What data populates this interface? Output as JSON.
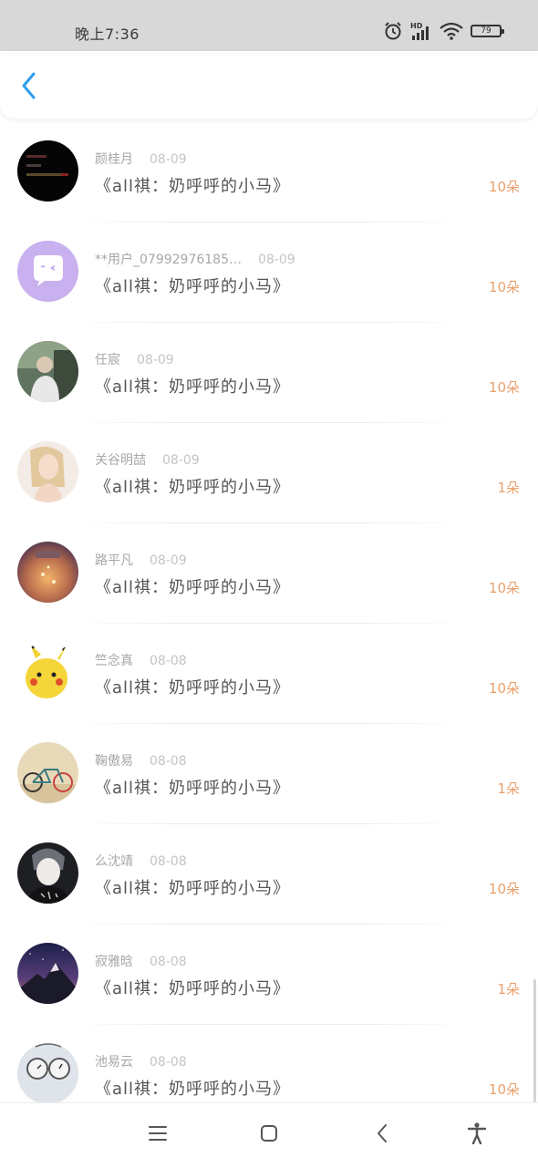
{
  "status_bar": {
    "time": "晚上7:36",
    "battery_level": "79",
    "icons": [
      "alarm-icon",
      "hd-signal-icon",
      "wifi-icon",
      "battery-icon"
    ]
  },
  "header": {
    "back_icon": "chevron-left-icon",
    "accent_color": "#2e9df0"
  },
  "colors": {
    "amount": "#e9a06b",
    "name": "#a7a7a7",
    "date": "#c4c4c4",
    "title": "#555555"
  },
  "list": [
    {
      "name": "颜桂月",
      "date": "08-09",
      "title": "《all祺：奶呼呼的小马》",
      "amount": "10朵"
    },
    {
      "name": "**用户_07992976185…",
      "date": "08-09",
      "title": "《all祺：奶呼呼的小马》",
      "amount": "10朵"
    },
    {
      "name": "任宸",
      "date": "08-09",
      "title": "《all祺：奶呼呼的小马》",
      "amount": "10朵"
    },
    {
      "name": "关谷明喆",
      "date": "08-09",
      "title": "《all祺：奶呼呼的小马》",
      "amount": "1朵"
    },
    {
      "name": "路平凡",
      "date": "08-09",
      "title": "《all祺：奶呼呼的小马》",
      "amount": "10朵"
    },
    {
      "name": "竺念真",
      "date": "08-08",
      "title": "《all祺：奶呼呼的小马》",
      "amount": "10朵"
    },
    {
      "name": "鞠傲易",
      "date": "08-08",
      "title": "《all祺：奶呼呼的小马》",
      "amount": "1朵"
    },
    {
      "name": "么沈靖",
      "date": "08-08",
      "title": "《all祺：奶呼呼的小马》",
      "amount": "10朵"
    },
    {
      "name": "寂雅晗",
      "date": "08-08",
      "title": "《all祺：奶呼呼的小马》",
      "amount": "1朵"
    },
    {
      "name": "池易云",
      "date": "08-08",
      "title": "《all祺：奶呼呼的小马》",
      "amount": "10朵"
    }
  ],
  "nav_bar": {
    "icons": [
      "menu-icon",
      "home-square-icon",
      "back-triangle-icon",
      "accessibility-icon"
    ]
  }
}
